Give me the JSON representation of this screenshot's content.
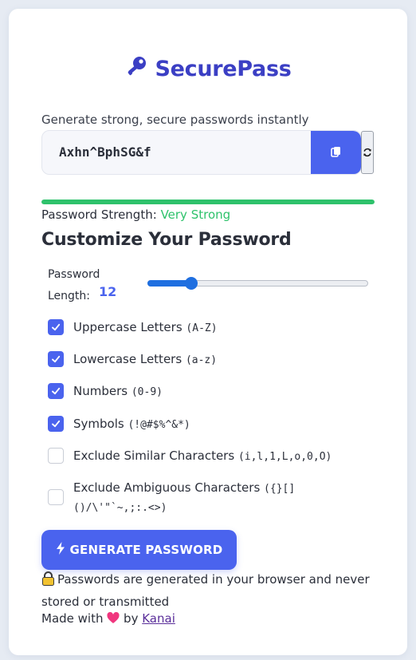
{
  "app": {
    "name": "SecurePass",
    "subtitle": "Generate strong, secure passwords instantly"
  },
  "password": {
    "value": "Axhn^BphSG&f",
    "copy_icon": "copy-icon",
    "refresh_icon": "refresh-icon"
  },
  "strength": {
    "label": "Password Strength:",
    "value": "Very Strong",
    "fill_fraction": 1.0,
    "color": "#2ec26b"
  },
  "customize": {
    "title": "Customize Your Password",
    "length_label": "Password Length:",
    "length_value": "12",
    "length_fraction": 0.2
  },
  "options": [
    {
      "label": "Uppercase Letters",
      "chars": "(A-Z)",
      "checked": true
    },
    {
      "label": "Lowercase Letters",
      "chars": "(a-z)",
      "checked": true
    },
    {
      "label": "Numbers",
      "chars": "(0-9)",
      "checked": true
    },
    {
      "label": "Symbols",
      "chars": "(!@#$%^&*)",
      "checked": true
    },
    {
      "label": "Exclude Similar Characters",
      "chars": "(i,l,1,L,o,0,O)",
      "checked": false
    },
    {
      "label": "Exclude Ambiguous Characters",
      "chars": "({}[]()/\\'\"`~,;:.<>)",
      "checked": false
    }
  ],
  "generate_button": "GENERATE PASSWORD",
  "note": "Passwords are generated in your browser and never stored or transmitted",
  "footer": {
    "prefix": "Made with",
    "by": "by",
    "author": "Kanai"
  },
  "colors": {
    "accent": "#4a63ee",
    "brand": "#3b3fc4",
    "success": "#2ec26b",
    "heart": "#f0367e"
  }
}
